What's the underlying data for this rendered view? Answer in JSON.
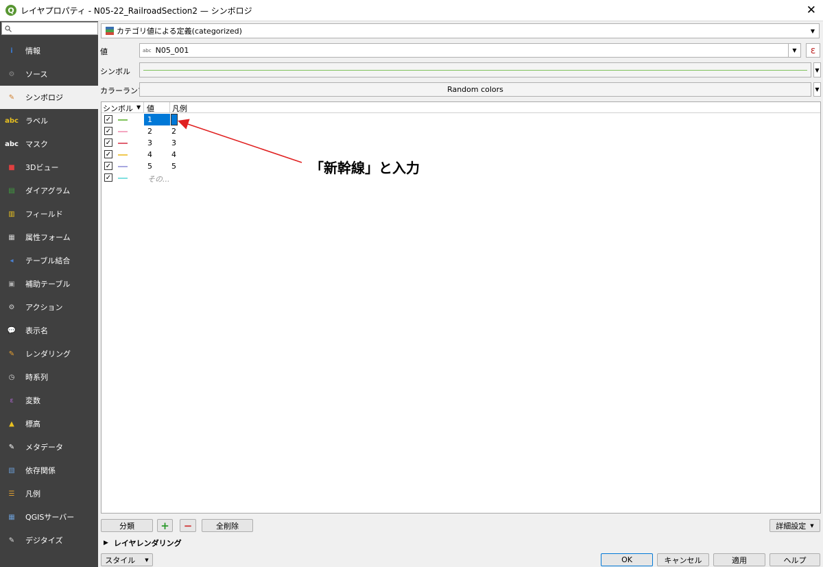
{
  "window": {
    "title": "レイヤプロパティ - N05-22_RailroadSection2 — シンボロジ"
  },
  "sidebar": {
    "items": [
      {
        "label": "情報",
        "icon": "info-icon"
      },
      {
        "label": "ソース",
        "icon": "source-icon"
      },
      {
        "label": "シンボロジ",
        "icon": "symbology-brush-icon"
      },
      {
        "label": "ラベル",
        "icon": "label-abc-icon"
      },
      {
        "label": "マスク",
        "icon": "mask-abc-icon"
      },
      {
        "label": "3Dビュー",
        "icon": "3d-cube-icon"
      },
      {
        "label": "ダイアグラム",
        "icon": "diagram-icon"
      },
      {
        "label": "フィールド",
        "icon": "fields-icon"
      },
      {
        "label": "属性フォーム",
        "icon": "attribute-form-icon"
      },
      {
        "label": "テーブル結合",
        "icon": "join-icon"
      },
      {
        "label": "補助テーブル",
        "icon": "auxiliary-storage-icon"
      },
      {
        "label": "アクション",
        "icon": "action-gear-icon"
      },
      {
        "label": "表示名",
        "icon": "display-speech-icon"
      },
      {
        "label": "レンダリング",
        "icon": "rendering-brush-icon"
      },
      {
        "label": "時系列",
        "icon": "temporal-clock-icon"
      },
      {
        "label": "変数",
        "icon": "variables-epsilon-icon"
      },
      {
        "label": "標高",
        "icon": "elevation-icon"
      },
      {
        "label": "メタデータ",
        "icon": "metadata-icon"
      },
      {
        "label": "依存関係",
        "icon": "dependencies-icon"
      },
      {
        "label": "凡例",
        "icon": "legend-icon"
      },
      {
        "label": "QGISサーバー",
        "icon": "qgis-server-icon"
      },
      {
        "label": "デジタイズ",
        "icon": "digitizing-icon"
      }
    ]
  },
  "renderer": {
    "label": "カテゴリ値による定義(categorized)"
  },
  "value": {
    "label": "値",
    "field": "N05_001",
    "expr_button": "ε"
  },
  "symbol": {
    "label": "シンボル"
  },
  "ramp": {
    "label": "カラーランプ",
    "value": "Random colors"
  },
  "table": {
    "headers": {
      "symbol": "シンボル",
      "value": "値",
      "legend": "凡例"
    },
    "rows": [
      {
        "checked": "✓",
        "color": "#7fc25a",
        "value": "1",
        "legend": ""
      },
      {
        "checked": "✓",
        "color": "#f4a6c0",
        "value": "2",
        "legend": "2"
      },
      {
        "checked": "✓",
        "color": "#e06070",
        "value": "3",
        "legend": "3"
      },
      {
        "checked": "✓",
        "color": "#f0c850",
        "value": "4",
        "legend": "4"
      },
      {
        "checked": "✓",
        "color": "#a8a8e0",
        "value": "5",
        "legend": "5"
      },
      {
        "checked": "✓",
        "color": "#80e0e0",
        "value": "",
        "legend": "その..."
      }
    ]
  },
  "buttons": {
    "classify": "分類",
    "add": "+",
    "remove": "−",
    "delete_all": "全削除",
    "advanced": "詳細設定",
    "layer_rendering": "レイヤレンダリング",
    "style": "スタイル",
    "ok": "OK",
    "cancel": "キャンセル",
    "apply": "適用",
    "help": "ヘルプ"
  },
  "annotation": {
    "text": "「新幹線」と入力",
    "color": "#e02020"
  }
}
